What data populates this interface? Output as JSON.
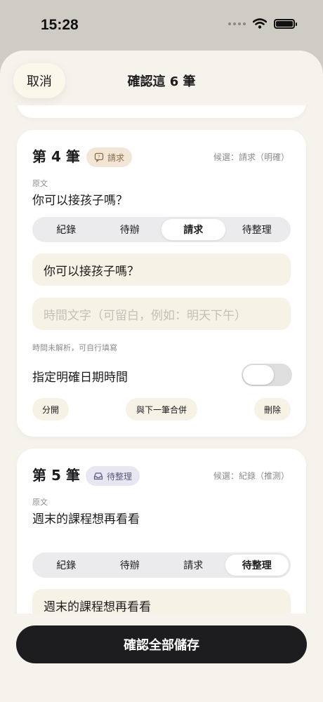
{
  "status_bar": {
    "time": "15:28"
  },
  "header": {
    "cancel_label": "取消",
    "title": "確認這 6 筆"
  },
  "segment_options": [
    "紀錄",
    "待辦",
    "請求",
    "待整理"
  ],
  "cards": [
    {
      "title": "第 4 筆",
      "badge": {
        "label": "請求",
        "icon": "speech-bubble-icon"
      },
      "candidate": "候選：請求（明確）",
      "original_label": "原文",
      "original_text": "你可以接孩子嗎？",
      "selected_segment": "請求",
      "content_value": "你可以接孩子嗎？",
      "time_placeholder": "時間文字（可留白，例如：明天下午）",
      "time_hint": "時間未解析，可自行填寫",
      "toggle_label": "指定明確日期時間",
      "toggle_on": false,
      "actions": {
        "split": "分開",
        "merge_next": "與下一筆合併",
        "delete": "刪除"
      }
    },
    {
      "title": "第 5 筆",
      "badge": {
        "label": "待整理",
        "icon": "inbox-tray-icon"
      },
      "candidate": "候選：紀錄（推測）",
      "original_label": "原文",
      "original_text": "週末的課程想再看看",
      "selected_segment": "待整理",
      "content_value": "週末的課程想再看看"
    }
  ],
  "footer": {
    "save_all_label": "確認全部儲存"
  }
}
